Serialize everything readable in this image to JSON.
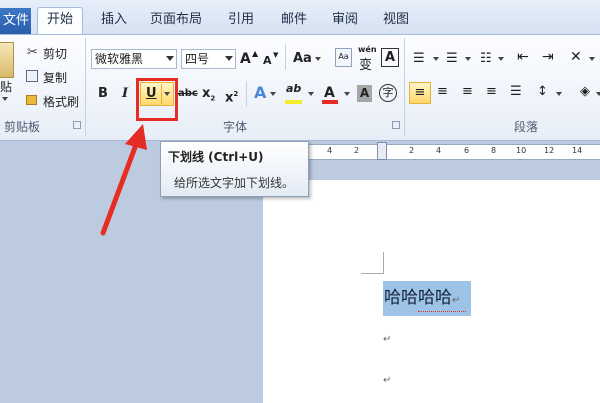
{
  "tabs": {
    "file": "文件",
    "items": [
      "开始",
      "插入",
      "页面布局",
      "引用",
      "邮件",
      "审阅",
      "视图"
    ]
  },
  "clipboard": {
    "paste": "贴",
    "cut": "剪切",
    "copy": "复制",
    "format_painter": "格式刷",
    "group_label": "剪贴板"
  },
  "font": {
    "font_name": "微软雅黑",
    "font_size": "四号",
    "grow": "A",
    "shrink": "A",
    "case": "Aa",
    "phonetic": "wén",
    "phonetic_char": "变",
    "border_char": "A",
    "bold": "B",
    "italic": "I",
    "underline": "U",
    "strike": "abc",
    "subscript": "x",
    "superscript": "x",
    "text_effect": "A",
    "highlight": "ab",
    "font_color": "A",
    "char_shading": "A",
    "enclose": "字",
    "group_label": "字体"
  },
  "paragraph": {
    "group_label": "段落"
  },
  "ruler": {
    "ticks": [
      "4",
      "2",
      "2",
      "4",
      "6",
      "8",
      "10",
      "12",
      "14"
    ]
  },
  "tooltip": {
    "title": "下划线 (Ctrl+U)",
    "description": "给所选文字加下划线。"
  },
  "document": {
    "selected_text": "哈哈哈哈",
    "para_mark": "↵"
  },
  "colors": {
    "accent_red": "#e52d23",
    "selection": "#9dc3e6",
    "file_tab": "#2a5fab"
  }
}
